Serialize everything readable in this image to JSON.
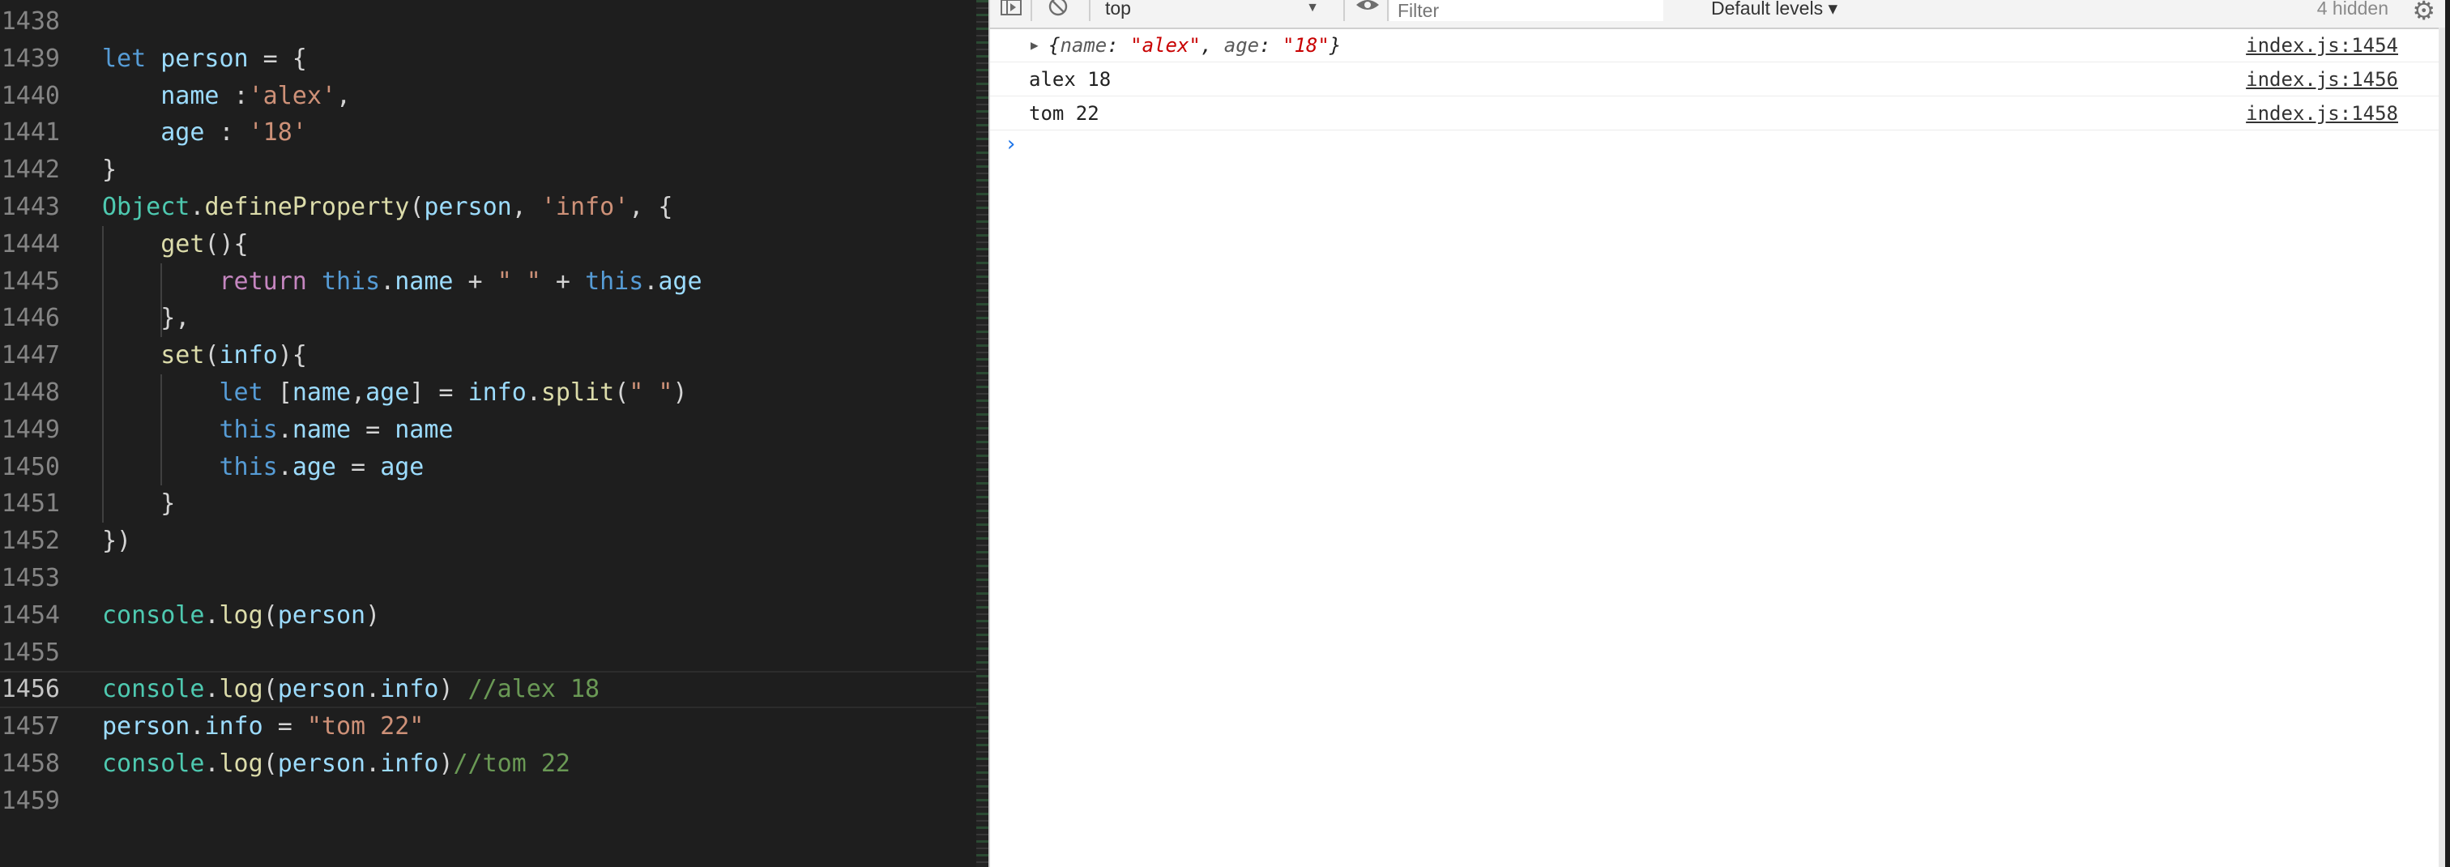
{
  "editor": {
    "lines": [
      {
        "num": "1438",
        "tokens": []
      },
      {
        "num": "1439",
        "tokens": [
          [
            "kw",
            "let"
          ],
          [
            "pun",
            " "
          ],
          [
            "var",
            "person"
          ],
          [
            "pun",
            " = {"
          ]
        ]
      },
      {
        "num": "1440",
        "tokens": [
          [
            "pun",
            "    "
          ],
          [
            "var",
            "name"
          ],
          [
            "pun",
            " :"
          ],
          [
            "str",
            "'alex'"
          ],
          [
            "pun",
            ","
          ]
        ]
      },
      {
        "num": "1441",
        "tokens": [
          [
            "pun",
            "    "
          ],
          [
            "var",
            "age"
          ],
          [
            "pun",
            " : "
          ],
          [
            "str",
            "'18'"
          ]
        ]
      },
      {
        "num": "1442",
        "tokens": [
          [
            "pun",
            "}"
          ]
        ]
      },
      {
        "num": "1443",
        "tokens": [
          [
            "cls",
            "Object"
          ],
          [
            "pun",
            "."
          ],
          [
            "fn",
            "defineProperty"
          ],
          [
            "pun",
            "("
          ],
          [
            "var",
            "person"
          ],
          [
            "pun",
            ", "
          ],
          [
            "str",
            "'info'"
          ],
          [
            "pun",
            ", {"
          ]
        ]
      },
      {
        "num": "1444",
        "tokens": [
          [
            "pun",
            "    "
          ],
          [
            "fn",
            "get"
          ],
          [
            "pun",
            "(){"
          ]
        ]
      },
      {
        "num": "1445",
        "tokens": [
          [
            "pun",
            "        "
          ],
          [
            "ret",
            "return"
          ],
          [
            "pun",
            " "
          ],
          [
            "kw",
            "this"
          ],
          [
            "pun",
            "."
          ],
          [
            "var",
            "name"
          ],
          [
            "pun",
            " + "
          ],
          [
            "str",
            "\" \""
          ],
          [
            "pun",
            " + "
          ],
          [
            "kw",
            "this"
          ],
          [
            "pun",
            "."
          ],
          [
            "var",
            "age"
          ]
        ]
      },
      {
        "num": "1446",
        "tokens": [
          [
            "pun",
            "    },"
          ]
        ]
      },
      {
        "num": "1447",
        "tokens": [
          [
            "pun",
            "    "
          ],
          [
            "fn",
            "set"
          ],
          [
            "pun",
            "("
          ],
          [
            "var",
            "info"
          ],
          [
            "pun",
            "){"
          ]
        ]
      },
      {
        "num": "1448",
        "tokens": [
          [
            "pun",
            "        "
          ],
          [
            "kw",
            "let"
          ],
          [
            "pun",
            " ["
          ],
          [
            "var",
            "name"
          ],
          [
            "pun",
            ","
          ],
          [
            "var",
            "age"
          ],
          [
            "pun",
            "] = "
          ],
          [
            "var",
            "info"
          ],
          [
            "pun",
            "."
          ],
          [
            "fn",
            "split"
          ],
          [
            "pun",
            "("
          ],
          [
            "str",
            "\" \""
          ],
          [
            "pun",
            ")"
          ]
        ]
      },
      {
        "num": "1449",
        "tokens": [
          [
            "pun",
            "        "
          ],
          [
            "kw",
            "this"
          ],
          [
            "pun",
            "."
          ],
          [
            "var",
            "name"
          ],
          [
            "pun",
            " = "
          ],
          [
            "var",
            "name"
          ]
        ]
      },
      {
        "num": "1450",
        "tokens": [
          [
            "pun",
            "        "
          ],
          [
            "kw",
            "this"
          ],
          [
            "pun",
            "."
          ],
          [
            "var",
            "age"
          ],
          [
            "pun",
            " = "
          ],
          [
            "var",
            "age"
          ]
        ]
      },
      {
        "num": "1451",
        "tokens": [
          [
            "pun",
            "    }"
          ]
        ]
      },
      {
        "num": "1452",
        "tokens": [
          [
            "pun",
            "})"
          ]
        ]
      },
      {
        "num": "1453",
        "tokens": []
      },
      {
        "num": "1454",
        "tokens": [
          [
            "cls",
            "console"
          ],
          [
            "pun",
            "."
          ],
          [
            "fn",
            "log"
          ],
          [
            "pun",
            "("
          ],
          [
            "var",
            "person"
          ],
          [
            "pun",
            ")"
          ]
        ]
      },
      {
        "num": "1455",
        "tokens": []
      },
      {
        "num": "1456",
        "tokens": [
          [
            "cls",
            "console"
          ],
          [
            "pun",
            "."
          ],
          [
            "fn",
            "log"
          ],
          [
            "pun",
            "("
          ],
          [
            "var",
            "person"
          ],
          [
            "pun",
            "."
          ],
          [
            "var",
            "info"
          ],
          [
            "pun",
            ") "
          ],
          [
            "cmt",
            "//alex 18"
          ]
        ]
      },
      {
        "num": "1457",
        "tokens": [
          [
            "var",
            "person"
          ],
          [
            "pun",
            "."
          ],
          [
            "var",
            "info"
          ],
          [
            "pun",
            " = "
          ],
          [
            "str",
            "\"tom 22\""
          ]
        ]
      },
      {
        "num": "1458",
        "tokens": [
          [
            "cls",
            "console"
          ],
          [
            "pun",
            "."
          ],
          [
            "fn",
            "log"
          ],
          [
            "pun",
            "("
          ],
          [
            "var",
            "person"
          ],
          [
            "pun",
            "."
          ],
          [
            "var",
            "info"
          ],
          [
            "pun",
            ")"
          ],
          [
            "cmt",
            "//tom 22"
          ]
        ]
      },
      {
        "num": "1459",
        "tokens": []
      }
    ],
    "current_line": "1456"
  },
  "devtools": {
    "context": "top",
    "filter_placeholder": "Filter",
    "levels": "Default levels ▾",
    "hidden": "4 hidden",
    "icons": {
      "sidebar": "sidebar-toggle-icon",
      "clear": "clear-console-icon",
      "eye": "live-expression-icon",
      "gear": "settings-gear-icon"
    },
    "messages": [
      {
        "object": true,
        "key1": "name",
        "val1": "\"alex\"",
        "key2": "age",
        "val2": "\"18\"",
        "source": "index.js:1454"
      },
      {
        "text": "alex 18",
        "source": "index.js:1456"
      },
      {
        "text": "tom 22",
        "source": "index.js:1458"
      }
    ],
    "prompt": "›"
  }
}
